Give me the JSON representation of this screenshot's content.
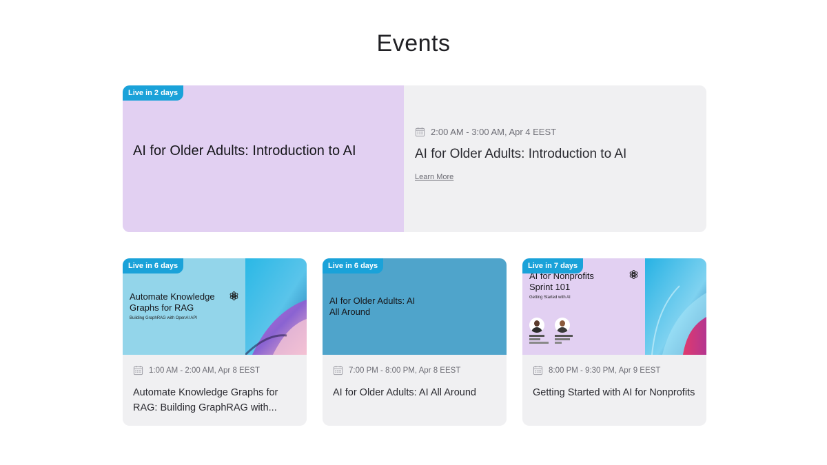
{
  "page": {
    "title": "Events"
  },
  "featured": {
    "badge": "Live in 2 days",
    "thumb_title": "AI for Older Adults: Introduction to AI",
    "thumb_color": "#e2d0f2",
    "datetime": "2:00 AM - 3:00 AM, Apr 4 EEST",
    "title": "AI for Older Adults: Introduction to AI",
    "link_label": "Learn More",
    "calendar_icon": "calendar-icon"
  },
  "cards": [
    {
      "badge": "Live in 6 days",
      "thumb_title": "Automate Knowledge Graphs for RAG",
      "thumb_subtitle": "Building GraphRAG with OpenAI API",
      "thumb_color": "#93d5ea",
      "logo_icon": "openai-logo-icon",
      "datetime": "1:00 AM - 2:00 AM, Apr 8 EEST",
      "title": "Automate Knowledge Graphs for RAG: Building GraphRAG with..."
    },
    {
      "badge": "Live in 6 days",
      "thumb_title": "AI for Older Adults: AI All Around",
      "thumb_color": "#4fa4cb",
      "datetime": "7:00 PM - 8:00 PM, Apr 8 EEST",
      "title": "AI for Older Adults: AI All Around"
    },
    {
      "badge": "Live in 7 days",
      "thumb_title": "AI for Nonprofits Sprint 101",
      "thumb_subtitle": "Getting Started with AI",
      "thumb_color": "#e2d0f2",
      "logo_icon": "openai-logo-icon",
      "datetime": "8:00 PM - 9:30 PM, Apr 9 EEST",
      "title": "Getting Started with AI for Nonprofits"
    }
  ],
  "colors": {
    "badge": "#1aa2d9",
    "card_bg": "#f0f0f2",
    "text_muted": "#6e6e76"
  }
}
